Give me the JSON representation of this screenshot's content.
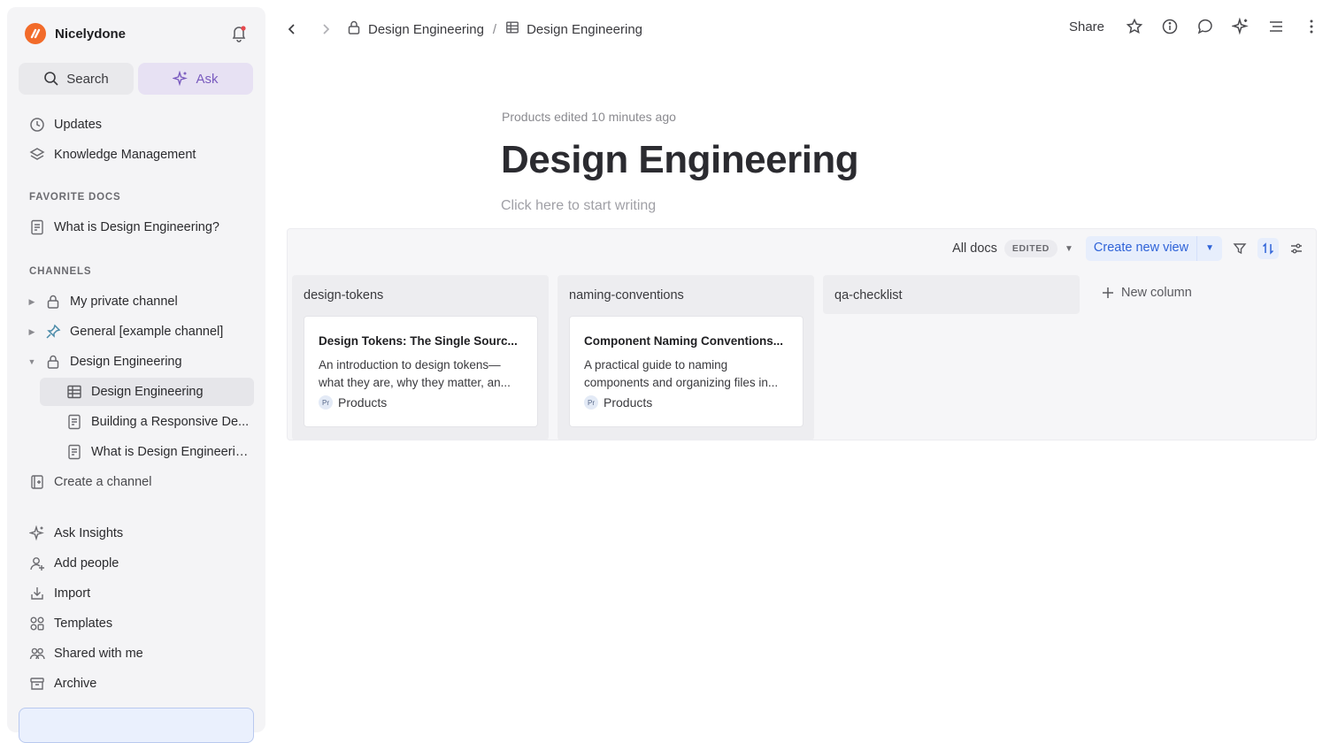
{
  "workspace": {
    "name": "Nicelydone"
  },
  "sidebar": {
    "search_label": "Search",
    "ask_label": "Ask",
    "top_items": [
      {
        "label": "Updates",
        "icon": "clock-icon"
      },
      {
        "label": "Knowledge Management",
        "icon": "layers-icon"
      }
    ],
    "favorites_heading": "FAVORITE DOCS",
    "favorites": [
      {
        "label": "What is Design Engineering?",
        "icon": "doc-icon"
      }
    ],
    "channels_heading": "CHANNELS",
    "channels": [
      {
        "label": "My private channel",
        "icon": "lock-icon",
        "expanded": false
      },
      {
        "label": "General [example channel]",
        "icon": "pin-icon",
        "expanded": false
      },
      {
        "label": "Design Engineering",
        "icon": "lock-icon",
        "expanded": true
      }
    ],
    "channel_children": [
      {
        "label": "Design Engineering",
        "icon": "table-icon",
        "active": true
      },
      {
        "label": "Building a Responsive De...",
        "icon": "doc-icon"
      },
      {
        "label": "What is Design Engineerin...",
        "icon": "doc-icon"
      }
    ],
    "create_channel": "Create a channel",
    "bottom_items": [
      {
        "label": "Ask Insights",
        "icon": "sparkle-icon"
      },
      {
        "label": "Add people",
        "icon": "add-user-icon"
      },
      {
        "label": "Import",
        "icon": "import-icon"
      },
      {
        "label": "Templates",
        "icon": "templates-icon"
      },
      {
        "label": "Shared with me",
        "icon": "shared-icon"
      },
      {
        "label": "Archive",
        "icon": "archive-icon"
      }
    ]
  },
  "header": {
    "breadcrumbs": [
      "Design Engineering",
      "Design Engineering"
    ],
    "share_label": "Share"
  },
  "doc": {
    "meta": "Products edited 10 minutes ago",
    "title": "Design Engineering",
    "placeholder": "Click here to start writing"
  },
  "board": {
    "view_label": "All docs",
    "badge": "EDITED",
    "create_view_label": "Create new view",
    "new_column_label": "New column",
    "columns": [
      {
        "name": "design-tokens",
        "cards": [
          {
            "title": "Design Tokens: The Single Sourc...",
            "desc": "An introduction to design tokens—what they are, why they matter, an...",
            "tag_abbr": "Pr",
            "tag": "Products"
          }
        ]
      },
      {
        "name": "naming-conventions",
        "cards": [
          {
            "title": "Component Naming Conventions...",
            "desc": "A practical guide to naming components and organizing files in...",
            "tag_abbr": "Pr",
            "tag": "Products"
          }
        ]
      },
      {
        "name": "qa-checklist",
        "cards": []
      }
    ]
  },
  "colors": {
    "accent_blue": "#2f63d8",
    "ask_purple": "#7a5bbf",
    "brand_orange": "#f26b2a",
    "sidebar_bg": "#f4f4f6"
  }
}
